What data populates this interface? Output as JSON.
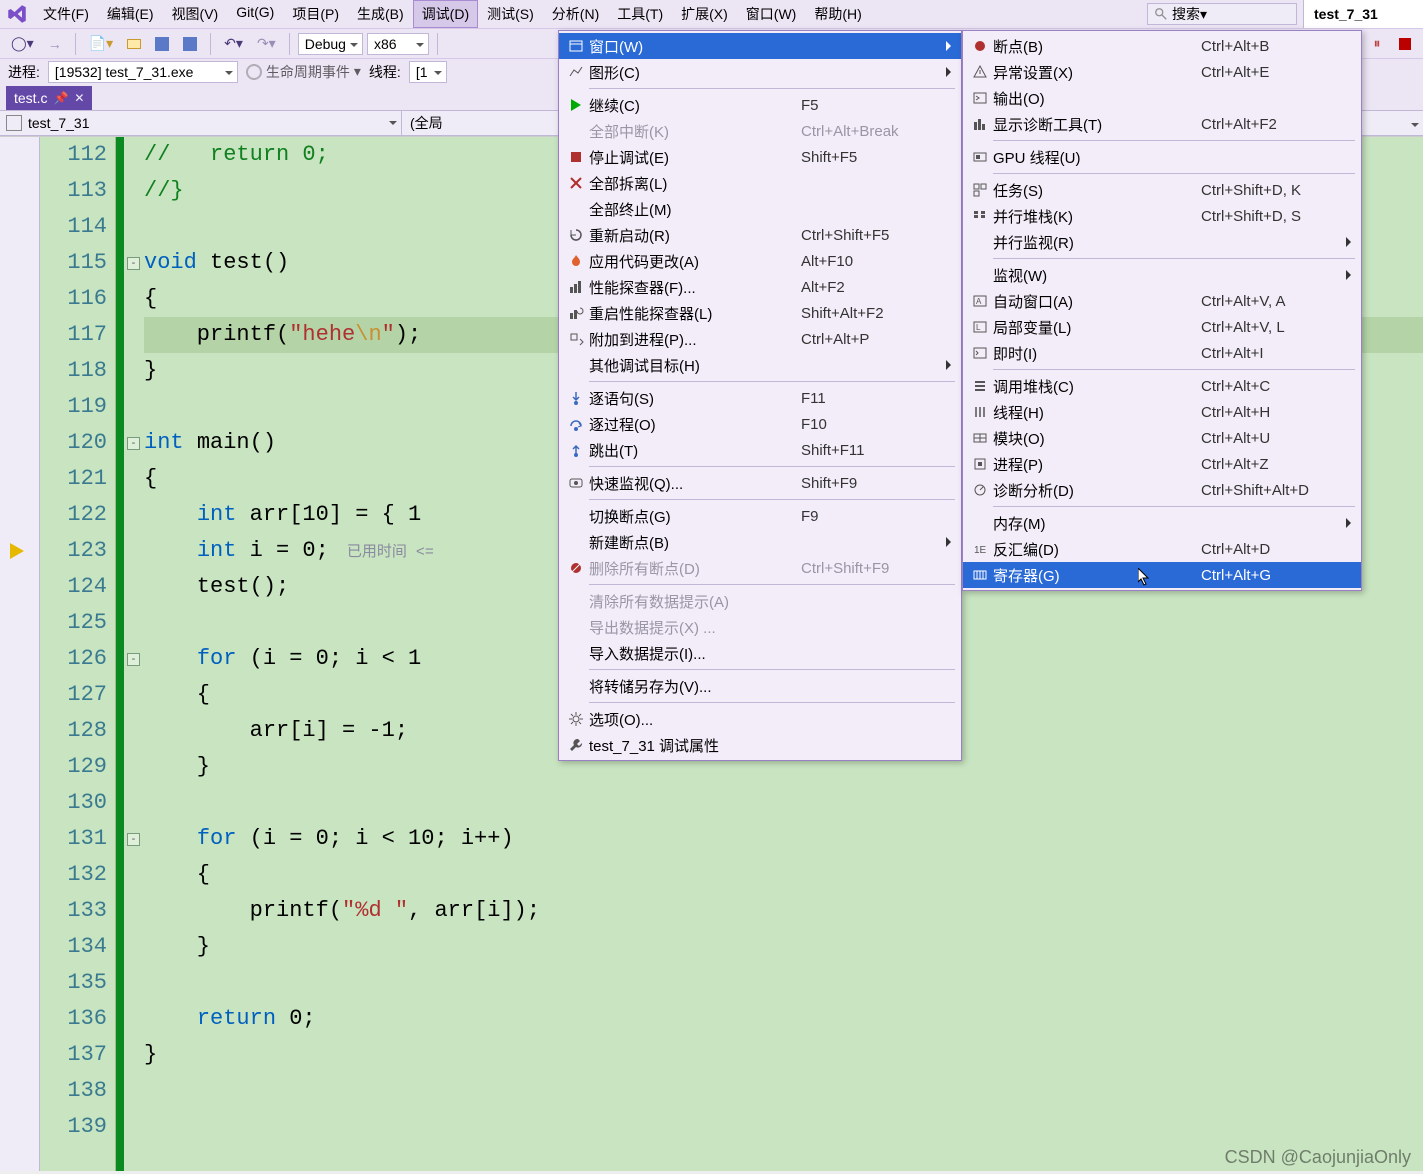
{
  "title_doc": "test_7_31",
  "menubar": {
    "items": [
      "文件(F)",
      "编辑(E)",
      "视图(V)",
      "Git(G)",
      "项目(P)",
      "生成(B)",
      "调试(D)",
      "测试(S)",
      "分析(N)",
      "工具(T)",
      "扩展(X)",
      "窗口(W)",
      "帮助(H)"
    ],
    "open_index": 6
  },
  "search": {
    "placeholder": "搜索▾"
  },
  "toolbar": {
    "config_label": "Debug",
    "platform_label": "x86"
  },
  "status": {
    "process_label": "进程:",
    "process_value": "[19532] test_7_31.exe",
    "lifecycle_label": "生命周期事件",
    "thread_label": "线程:",
    "thread_value": "[1"
  },
  "doctab": {
    "label": "test.c",
    "pin": "📌",
    "close": "✕"
  },
  "navbar": {
    "project": "test_7_31",
    "scope": "(全局"
  },
  "code": {
    "lines_start": 112,
    "lines_end": 139,
    "arrow_at": 123,
    "highlight_at": 117,
    "hint_text": "已用时间 <=",
    "lines": {
      "112": {
        "t": "//   return 0;",
        "cls": "c-cm"
      },
      "113": {
        "t": "//}",
        "cls": "c-cm"
      },
      "114": {
        "t": ""
      },
      "115": {
        "segs": [
          {
            "t": "void ",
            "c": "c-kw"
          },
          {
            "t": "test()"
          }
        ]
      },
      "116": {
        "t": "{"
      },
      "117": {
        "segs": [
          {
            "t": "    printf("
          },
          {
            "t": "\"hehe",
            "c": "c-str"
          },
          {
            "t": "\\n",
            "c": "c-esc"
          },
          {
            "t": "\"",
            "c": "c-str"
          },
          {
            "t": ");"
          }
        ]
      },
      "118": {
        "t": "}"
      },
      "119": {
        "t": ""
      },
      "120": {
        "segs": [
          {
            "t": "int ",
            "c": "c-kw"
          },
          {
            "t": "main()"
          }
        ]
      },
      "121": {
        "t": "{"
      },
      "122": {
        "segs": [
          {
            "t": "    "
          },
          {
            "t": "int ",
            "c": "c-kw"
          },
          {
            "t": "arr[10] = { 1"
          }
        ]
      },
      "123": {
        "segs": [
          {
            "t": "    "
          },
          {
            "t": "int ",
            "c": "c-kw"
          },
          {
            "t": "i = 0;"
          }
        ],
        "hint": true
      },
      "124": {
        "t": "    test();"
      },
      "125": {
        "t": ""
      },
      "126": {
        "segs": [
          {
            "t": "    "
          },
          {
            "t": "for ",
            "c": "c-kw"
          },
          {
            "t": "(i = 0; i < 1"
          }
        ]
      },
      "127": {
        "t": "    {"
      },
      "128": {
        "t": "        arr[i] = -1;"
      },
      "129": {
        "t": "    }"
      },
      "130": {
        "t": ""
      },
      "131": {
        "segs": [
          {
            "t": "    "
          },
          {
            "t": "for ",
            "c": "c-kw"
          },
          {
            "t": "(i = 0; i < 10; i++)"
          }
        ]
      },
      "132": {
        "t": "    {"
      },
      "133": {
        "segs": [
          {
            "t": "        printf("
          },
          {
            "t": "\"%d \"",
            "c": "c-str"
          },
          {
            "t": ", arr[i]);"
          }
        ]
      },
      "134": {
        "t": "    }"
      },
      "135": {
        "t": ""
      },
      "136": {
        "segs": [
          {
            "t": "    "
          },
          {
            "t": "return ",
            "c": "c-kw"
          },
          {
            "t": "0;"
          }
        ]
      },
      "137": {
        "t": "}"
      },
      "138": {
        "t": ""
      },
      "139": {
        "t": ""
      }
    },
    "folds": [
      115,
      120,
      126,
      131
    ]
  },
  "menu_debug": {
    "items": [
      {
        "ico": "win",
        "label": "窗口(W)",
        "arrow": true,
        "highlight": true
      },
      {
        "ico": "graph",
        "label": "图形(C)",
        "arrow": true
      },
      {
        "sep": true
      },
      {
        "ico": "play",
        "label": "继续(C)",
        "sc": "F5"
      },
      {
        "ico": "",
        "label": "全部中断(K)",
        "sc": "Ctrl+Alt+Break",
        "disabled": true
      },
      {
        "ico": "stop",
        "label": "停止调试(E)",
        "sc": "Shift+F5"
      },
      {
        "ico": "x",
        "label": "全部拆离(L)"
      },
      {
        "ico": "",
        "label": "全部终止(M)"
      },
      {
        "ico": "restart",
        "label": "重新启动(R)",
        "sc": "Ctrl+Shift+F5"
      },
      {
        "ico": "fire",
        "label": "应用代码更改(A)",
        "sc": "Alt+F10"
      },
      {
        "ico": "perf",
        "label": "性能探查器(F)...",
        "sc": "Alt+F2"
      },
      {
        "ico": "perfr",
        "label": "重启性能探查器(L)",
        "sc": "Shift+Alt+F2"
      },
      {
        "ico": "attach",
        "label": "附加到进程(P)...",
        "sc": "Ctrl+Alt+P"
      },
      {
        "ico": "",
        "label": "其他调试目标(H)",
        "arrow": true
      },
      {
        "sep": true
      },
      {
        "ico": "stepinto",
        "label": "逐语句(S)",
        "sc": "F11"
      },
      {
        "ico": "stepover",
        "label": "逐过程(O)",
        "sc": "F10"
      },
      {
        "ico": "stepout",
        "label": "跳出(T)",
        "sc": "Shift+F11"
      },
      {
        "sep": true
      },
      {
        "ico": "watch",
        "label": "快速监视(Q)...",
        "sc": "Shift+F9"
      },
      {
        "sep": true
      },
      {
        "ico": "",
        "label": "切换断点(G)",
        "sc": "F9"
      },
      {
        "ico": "",
        "label": "新建断点(B)",
        "arrow": true
      },
      {
        "ico": "delbp",
        "label": "删除所有断点(D)",
        "sc": "Ctrl+Shift+F9",
        "disabled": true
      },
      {
        "sep": true
      },
      {
        "ico": "",
        "label": "清除所有数据提示(A)",
        "disabled": true
      },
      {
        "ico": "",
        "label": "导出数据提示(X) ...",
        "disabled": true
      },
      {
        "ico": "",
        "label": "导入数据提示(I)..."
      },
      {
        "sep": true
      },
      {
        "ico": "",
        "label": "将转储另存为(V)..."
      },
      {
        "sep": true
      },
      {
        "ico": "gear",
        "label": "选项(O)..."
      },
      {
        "ico": "wrench",
        "label": "test_7_31 调试属性"
      }
    ]
  },
  "menu_windows": {
    "items": [
      {
        "ico": "bp",
        "label": "断点(B)",
        "sc": "Ctrl+Alt+B"
      },
      {
        "ico": "exc",
        "label": "异常设置(X)",
        "sc": "Ctrl+Alt+E"
      },
      {
        "ico": "out",
        "label": "输出(O)"
      },
      {
        "ico": "diag",
        "label": "显示诊断工具(T)",
        "sc": "Ctrl+Alt+F2"
      },
      {
        "sep": true
      },
      {
        "ico": "gpu",
        "label": "GPU 线程(U)"
      },
      {
        "sep": true
      },
      {
        "ico": "task",
        "label": "任务(S)",
        "sc": "Ctrl+Shift+D, K"
      },
      {
        "ico": "pstack",
        "label": "并行堆栈(K)",
        "sc": "Ctrl+Shift+D, S"
      },
      {
        "ico": "",
        "label": "并行监视(R)",
        "arrow": true
      },
      {
        "sep": true
      },
      {
        "ico": "",
        "label": "监视(W)",
        "arrow": true
      },
      {
        "ico": "auto",
        "label": "自动窗口(A)",
        "sc": "Ctrl+Alt+V, A"
      },
      {
        "ico": "local",
        "label": "局部变量(L)",
        "sc": "Ctrl+Alt+V, L"
      },
      {
        "ico": "imm",
        "label": "即时(I)",
        "sc": "Ctrl+Alt+I"
      },
      {
        "sep": true
      },
      {
        "ico": "cstack",
        "label": "调用堆栈(C)",
        "sc": "Ctrl+Alt+C"
      },
      {
        "ico": "thread",
        "label": "线程(H)",
        "sc": "Ctrl+Alt+H"
      },
      {
        "ico": "module",
        "label": "模块(O)",
        "sc": "Ctrl+Alt+U"
      },
      {
        "ico": "proc",
        "label": "进程(P)",
        "sc": "Ctrl+Alt+Z"
      },
      {
        "ico": "danal",
        "label": "诊断分析(D)",
        "sc": "Ctrl+Shift+Alt+D"
      },
      {
        "sep": true
      },
      {
        "ico": "",
        "label": "内存(M)",
        "arrow": true
      },
      {
        "ico": "disasm",
        "label": "反汇编(D)",
        "sc": "Ctrl+Alt+D"
      },
      {
        "ico": "reg",
        "label": "寄存器(G)",
        "sc": "Ctrl+Alt+G",
        "highlight": true
      }
    ]
  },
  "watermark": "CSDN @CaojunjiaOnly"
}
